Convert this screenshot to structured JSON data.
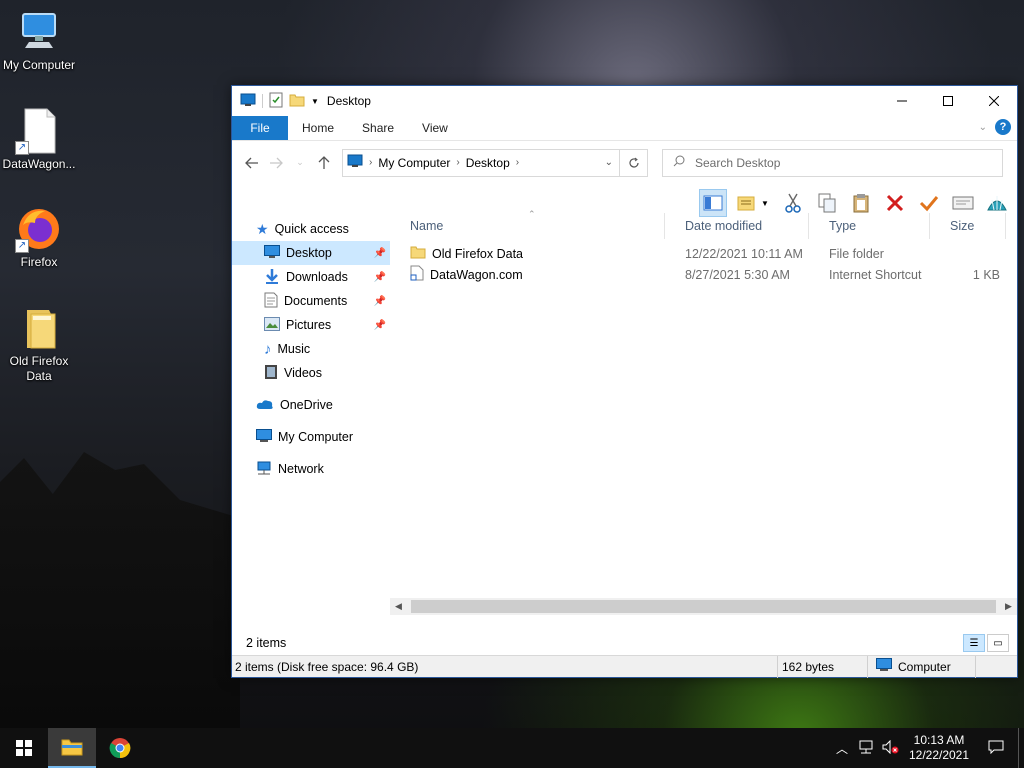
{
  "desktop": {
    "icons": [
      {
        "label": "My Computer"
      },
      {
        "label": "DataWagon..."
      },
      {
        "label": "Firefox"
      },
      {
        "label": "Old Firefox Data"
      }
    ]
  },
  "window": {
    "title": "Desktop",
    "ribbon_tabs": [
      "File",
      "Home",
      "Share",
      "View"
    ],
    "help_label": "?",
    "address": {
      "segments": [
        "My Computer",
        "Desktop"
      ]
    },
    "search": {
      "placeholder": "Search Desktop"
    },
    "nav": {
      "quick_access": "Quick access",
      "pinned": [
        "Desktop",
        "Downloads",
        "Documents",
        "Pictures"
      ],
      "libraries": [
        "Music",
        "Videos"
      ],
      "onedrive": "OneDrive",
      "my_computer": "My Computer",
      "network": "Network"
    },
    "columns": [
      "Name",
      "Date modified",
      "Type",
      "Size"
    ],
    "files": [
      {
        "name": "Old Firefox Data",
        "date": "12/22/2021 10:11 AM",
        "type": "File folder",
        "size": "",
        "icon": "folder-icon"
      },
      {
        "name": "DataWagon.com",
        "date": "8/27/2021 5:30 AM",
        "type": "Internet Shortcut",
        "size": "1 KB",
        "icon": "shortcut-file-icon"
      }
    ],
    "item_count": "2 items",
    "status": {
      "disk": "2 items (Disk free space: 96.4 GB)",
      "bytes": "162 bytes",
      "location": "Computer"
    }
  },
  "taskbar": {
    "time": "10:13 AM",
    "date": "12/22/2021"
  },
  "colors": {
    "accent": "#1979ca",
    "selection": "#cce8ff",
    "taskbar": "#101010"
  }
}
